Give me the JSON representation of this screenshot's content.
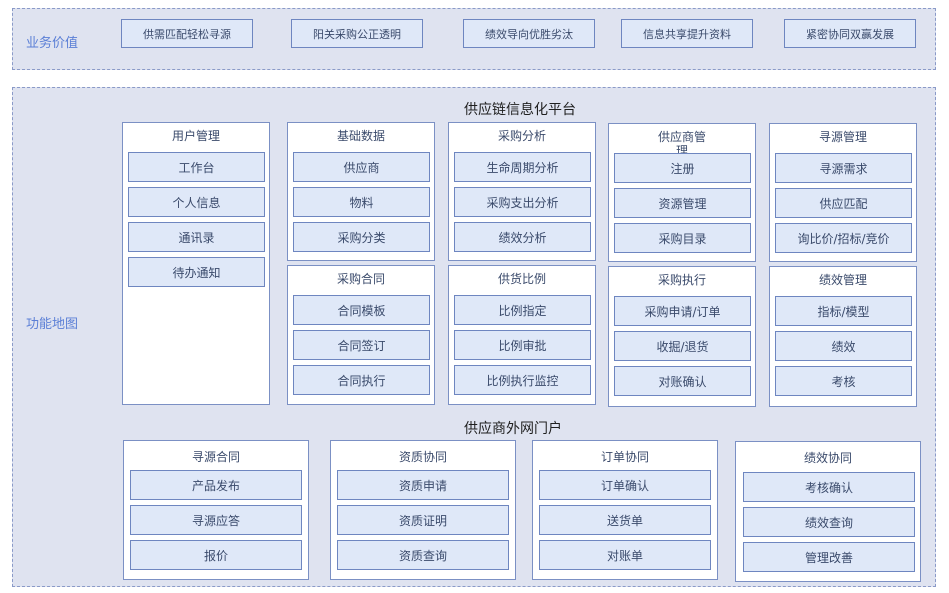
{
  "business_value": {
    "label": "业务价值",
    "items": [
      "供需匹配轻松寻源",
      "阳关采购公正透明",
      "绩效导向优胜劣汰",
      "信息共享提升资料",
      "紧密协同双赢发展"
    ]
  },
  "function_map": {
    "label": "功能地图",
    "platform": {
      "title": "供应链信息化平台",
      "modules": [
        {
          "title": "用户管理",
          "items": [
            "工作台",
            "个人信息",
            "通讯录",
            "待办通知"
          ]
        },
        {
          "title": "基础数据",
          "items": [
            "供应商",
            "物料",
            "采购分类"
          ]
        },
        {
          "title": "采购分析",
          "items": [
            "生命周期分析",
            "采购支出分析",
            "绩效分析"
          ]
        },
        {
          "title": "供应商管理",
          "items": [
            "注册",
            "资源管理",
            "采购目录"
          ]
        },
        {
          "title": "寻源管理",
          "items": [
            "寻源需求",
            "供应匹配",
            "询比价/招标/竞价"
          ]
        },
        {
          "title": "采购合同",
          "items": [
            "合同模板",
            "合同签订",
            "合同执行"
          ]
        },
        {
          "title": "供货比例",
          "items": [
            "比例指定",
            "比例审批",
            "比例执行监控"
          ]
        },
        {
          "title": "采购执行",
          "items": [
            "采购申请/订单",
            "收掘/退货",
            "对账确认"
          ]
        },
        {
          "title": "绩效管理",
          "items": [
            "指标/模型",
            "绩效",
            "考核"
          ]
        }
      ]
    },
    "portal": {
      "title": "供应商外网门户",
      "modules": [
        {
          "title": "寻源合同",
          "items": [
            "产品发布",
            "寻源应答",
            "报价"
          ]
        },
        {
          "title": "资质协同",
          "items": [
            "资质申请",
            "资质证明",
            "资质查询"
          ]
        },
        {
          "title": "订单协同",
          "items": [
            "订单确认",
            "送货单",
            "对账单"
          ]
        },
        {
          "title": "绩效协同",
          "items": [
            "考核确认",
            "绩效查询",
            "管理改善"
          ]
        }
      ]
    }
  },
  "colors": {
    "band_background": "#dfe3f0",
    "band_border": "#8a9ac8",
    "label_blue": "#5b7fd6",
    "item_fill": "#dfe8f8",
    "item_border": "#6e86c0"
  }
}
